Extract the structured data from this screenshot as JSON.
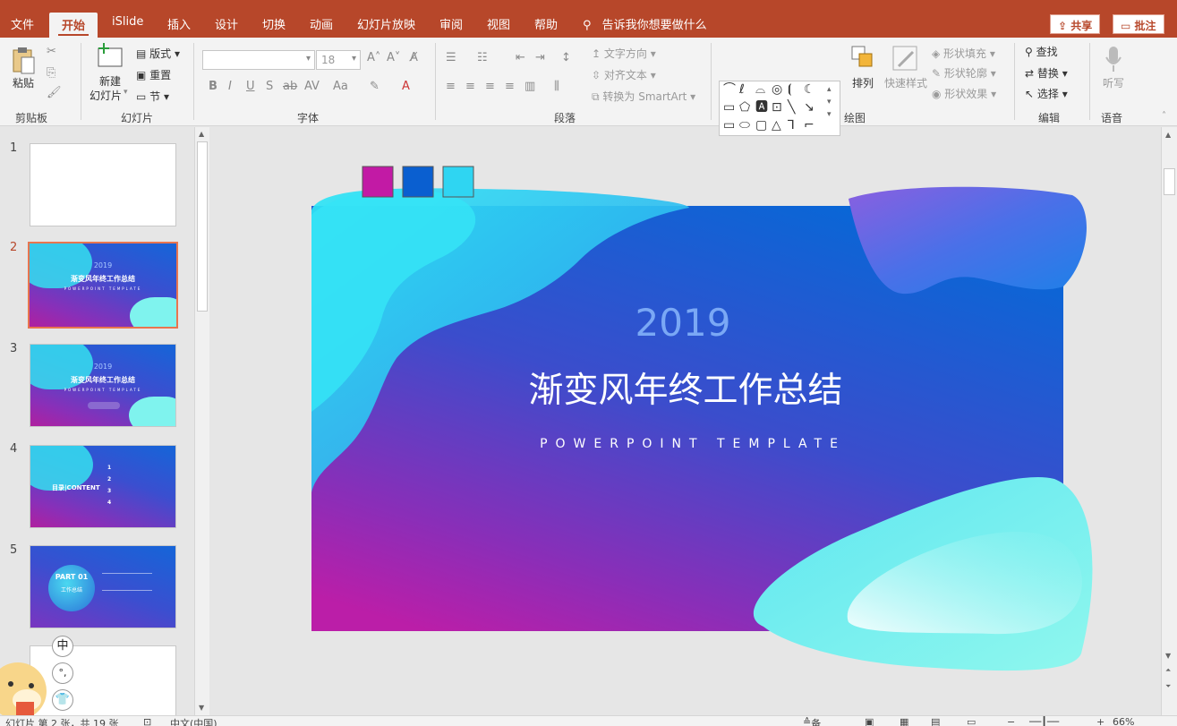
{
  "menu": {
    "tabs": [
      "文件",
      "开始",
      "iSlide",
      "插入",
      "设计",
      "切换",
      "动画",
      "幻灯片放映",
      "审阅",
      "视图",
      "帮助"
    ],
    "active_index": 1,
    "tell_me": "告诉我你想要做什么",
    "share": "共享",
    "comments": "批注"
  },
  "ribbon": {
    "clipboard": {
      "label": "剪贴板",
      "paste": "粘贴"
    },
    "slides": {
      "label": "幻灯片",
      "new_slide": "新建",
      "new_slide2": "幻灯片",
      "layout": "版式",
      "reset": "重置",
      "section": "节"
    },
    "font": {
      "label": "字体",
      "font_name": "",
      "font_size": "18"
    },
    "paragraph": {
      "label": "段落",
      "text_direction": "文字方向",
      "align_text": "对齐文本",
      "smartart": "转换为 SmartArt"
    },
    "drawing": {
      "label": "绘图",
      "arrange": "排列",
      "quick_styles": "快速样式",
      "fill": "形状填充",
      "outline": "形状轮廓",
      "effects": "形状效果"
    },
    "editing": {
      "label": "编辑",
      "find": "查找",
      "replace": "替换",
      "select": "选择"
    },
    "voice": {
      "label": "语音",
      "dictate": "听写"
    }
  },
  "thumbnails": [
    {
      "num": "1"
    },
    {
      "num": "2",
      "year": "2019",
      "title": "渐变风年终工作总结",
      "sub": "POWERPOINT TEMPLATE"
    },
    {
      "num": "3",
      "year": "2019",
      "title": "渐变风年终工作总结",
      "sub": "POWERPOINT TEMPLATE"
    },
    {
      "num": "4",
      "title": "目录|CONTENT",
      "items": [
        "1",
        "2",
        "3",
        "4"
      ]
    },
    {
      "num": "5",
      "title": "PART 01",
      "sub": "工作总结"
    }
  ],
  "slide": {
    "year": "2019",
    "title": "渐变风年终工作总结",
    "subtitle": "POWERPOINT TEMPLATE",
    "swatches": [
      "#c21aa5",
      "#0a5fd0",
      "#2fd5f2"
    ]
  },
  "status": {
    "slide_info": "幻灯片 第 2 张，共 19 张",
    "language": "中文(中国)",
    "notes": "备注",
    "zoom": "66%"
  },
  "ime": {
    "lang": "中",
    "punct": "°,"
  }
}
